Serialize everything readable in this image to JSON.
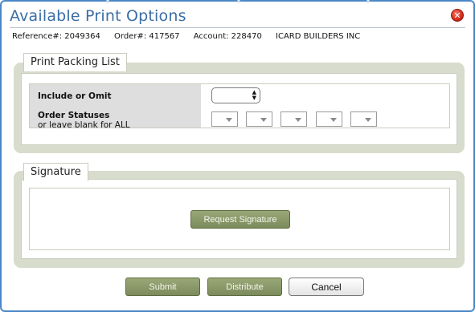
{
  "dialog": {
    "title": "Available Print Options",
    "close_icon": "close-icon"
  },
  "info": {
    "reference": "Reference#: 2049364",
    "order": "Order#: 417567",
    "account": "Account: 228470",
    "company": "ICARD BUILDERS INC"
  },
  "packing": {
    "legend": "Print Packing List",
    "include_label": "Include or Omit",
    "statuses_label": "Order Statuses",
    "statuses_sub": "or leave blank for ALL",
    "include_value": "",
    "status_values": [
      "",
      "",
      "",
      "",
      ""
    ]
  },
  "signature": {
    "legend": "Signature",
    "request_button": "Request Signature"
  },
  "footer": {
    "submit": "Submit",
    "distribute": "Distribute",
    "cancel": "Cancel"
  },
  "colors": {
    "title_blue": "#3b6ea5",
    "frame_blue": "#4a87c8",
    "section_bg": "#d7dccc",
    "button_green": "#7c8b5c",
    "close_red": "#d9301e"
  }
}
